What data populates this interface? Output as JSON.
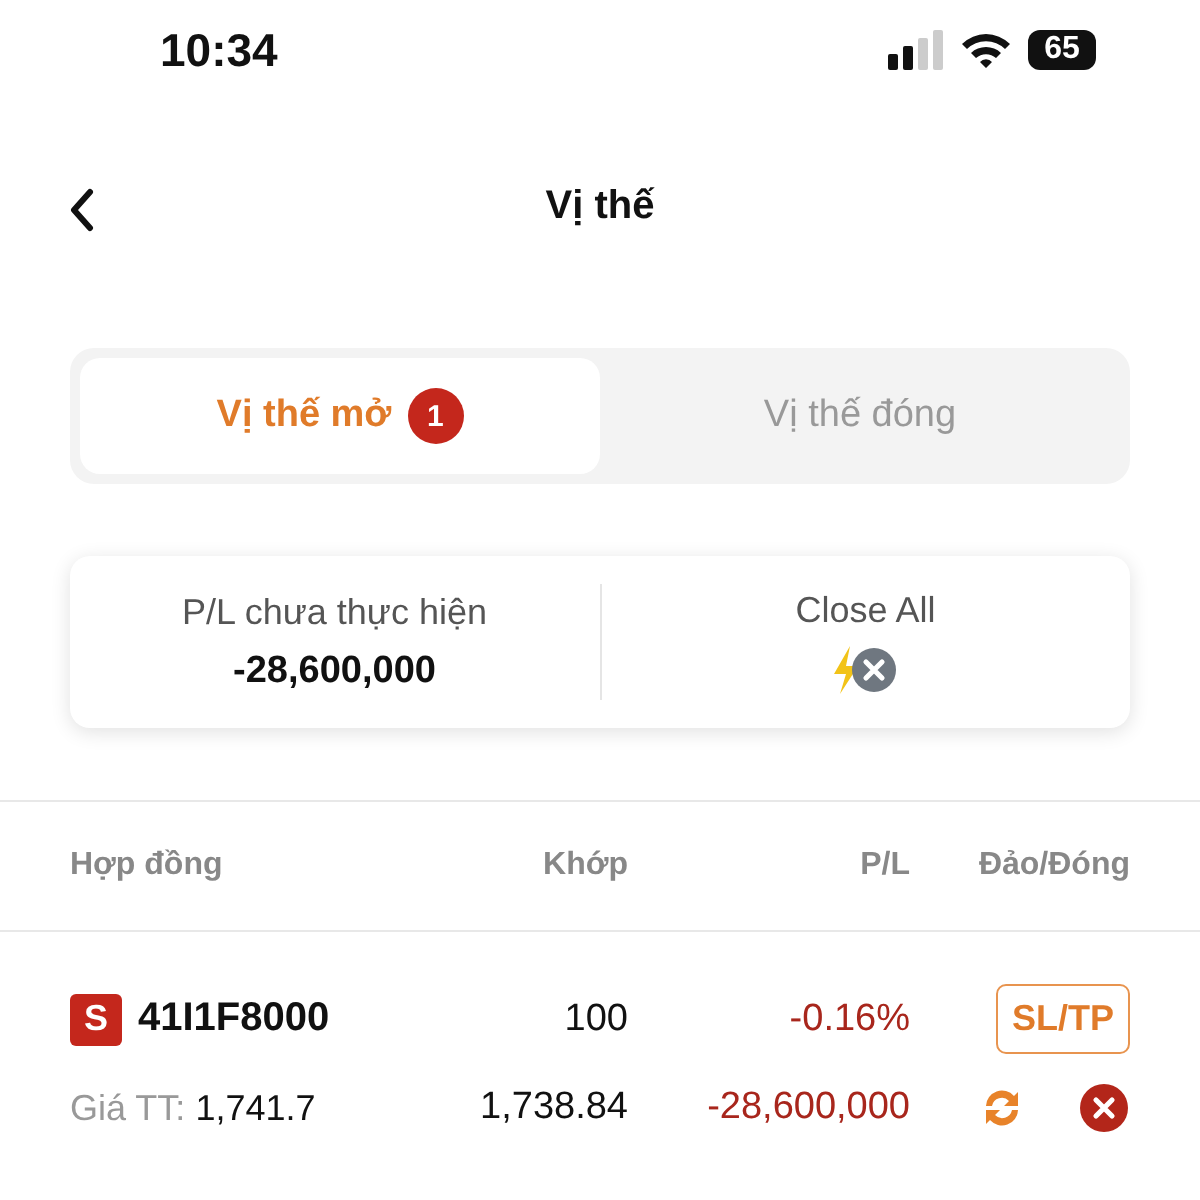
{
  "status_bar": {
    "time": "10:34",
    "battery": "65"
  },
  "header": {
    "title": "Vị thế"
  },
  "tabs": [
    {
      "label": "Vị thế mở",
      "badge": "1",
      "selected": true
    },
    {
      "label": "Vị thế đóng",
      "selected": false
    }
  ],
  "summary": {
    "pl_label": "P/L chưa thực hiện",
    "pl_value": "-28,600,000",
    "close_all_label": "Close All"
  },
  "table": {
    "columns": [
      "Hợp đồng",
      "Khớp",
      "P/L",
      "Đảo/Đóng"
    ],
    "rows": [
      {
        "side": "S",
        "contract": "41I1F8000",
        "price_label": "Giá TT:",
        "price": "1,741.7",
        "qty": "100",
        "match_price": "1,738.84",
        "pl_pct": "-0.16%",
        "pl_value": "-28,600,000",
        "action": "SL/TP"
      }
    ]
  }
}
